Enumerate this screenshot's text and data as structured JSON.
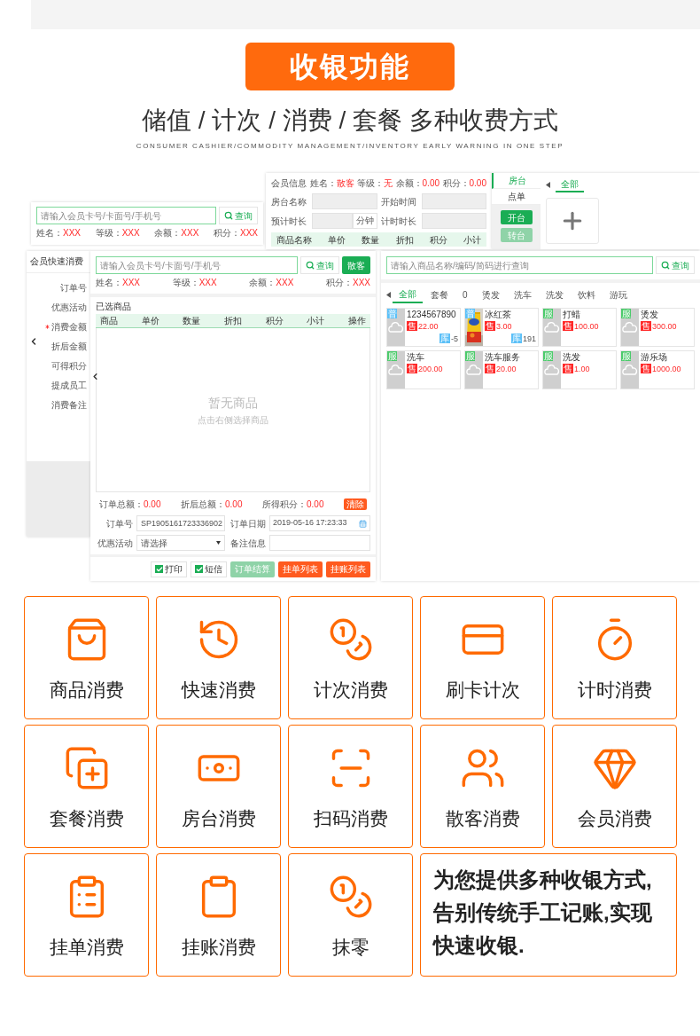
{
  "header": {
    "title": "收银功能",
    "subtitle": "储值 / 计次 / 消费 / 套餐 多种收费方式",
    "tagline": "CONSUMER CASHIER/COMMODITY MANAGEMENT/INVENTORY EARLY WARNING IN ONE STEP"
  },
  "member_lookup": {
    "search_placeholder": "请输入会员卡号/卡面号/手机号",
    "search_button": "查询",
    "info": [
      {
        "label": "姓名：",
        "value": "XXX"
      },
      {
        "label": "等级：",
        "value": "XXX"
      },
      {
        "label": "余额：",
        "value": "XXX"
      },
      {
        "label": "积分：",
        "value": "XXX"
      }
    ]
  },
  "room_panel": {
    "member_label": "会员信息",
    "info": [
      {
        "label": "姓名：",
        "value": "散客"
      },
      {
        "label": "等级：",
        "value": "无"
      },
      {
        "label": "余额：",
        "value": "0.00"
      },
      {
        "label": "积分：",
        "value": "0.00"
      }
    ],
    "fields": [
      {
        "label": "房台名称"
      },
      {
        "label": "开始时间"
      },
      {
        "label": "预计时长",
        "unit": "分钟"
      },
      {
        "label": "计时时长"
      }
    ],
    "columns": [
      "商品名称",
      "单价",
      "数量",
      "折扣",
      "积分",
      "小计"
    ]
  },
  "room_tabs": {
    "tabs": [
      {
        "label": "房台",
        "selected": true
      },
      {
        "label": "点单",
        "selected": false
      }
    ],
    "buttons": [
      {
        "label": "开台",
        "disabled": false
      },
      {
        "label": "转台",
        "disabled": true
      }
    ],
    "area_tabs": [
      {
        "label": "全部",
        "selected": true
      }
    ]
  },
  "sidebar": {
    "title": "会员快速消费",
    "labels": [
      {
        "text": "订单号",
        "required": false
      },
      {
        "text": "优惠活动",
        "required": false
      },
      {
        "text": "消费金额",
        "required": true
      },
      {
        "text": "折后金额",
        "required": false
      },
      {
        "text": "可得积分",
        "required": false
      },
      {
        "text": "提成员工",
        "required": false
      },
      {
        "text": "消费备注",
        "required": false
      }
    ]
  },
  "order": {
    "search_placeholder": "请输入会员卡号/卡面号/手机号",
    "search_button": "查询",
    "guest_button": "散客",
    "info": [
      {
        "label": "姓名：",
        "value": "XXX"
      },
      {
        "label": "等级：",
        "value": "XXX"
      },
      {
        "label": "余额：",
        "value": "XXX"
      },
      {
        "label": "积分：",
        "value": "XXX"
      }
    ],
    "section_title": "已选商品",
    "columns": [
      "商品",
      "单价",
      "数量",
      "折扣",
      "积分",
      "小计",
      "操作"
    ],
    "empty_title": "暂无商品",
    "empty_hint": "点击右侧选择商品",
    "totals": [
      {
        "label": "订单总额：",
        "value": "0.00"
      },
      {
        "label": "折后总额：",
        "value": "0.00"
      },
      {
        "label": "所得积分：",
        "value": "0.00"
      }
    ],
    "clear_button": "清除",
    "fields": [
      {
        "label": "订单号",
        "kind": "text",
        "value": "SP1905161723336902"
      },
      {
        "label": "订单日期",
        "kind": "date",
        "value": "2019-05-16 17:23:33"
      },
      {
        "label": "优惠活动",
        "kind": "select",
        "value": "请选择"
      },
      {
        "label": "备注信息",
        "kind": "text"
      }
    ],
    "options": [
      {
        "label": "打印",
        "checked": true
      },
      {
        "label": "短信",
        "checked": true
      }
    ],
    "actions": [
      {
        "label": "订单结算",
        "kind": "confirm",
        "disabled": true
      },
      {
        "label": "挂单列表",
        "kind": "list",
        "disabled": false
      },
      {
        "label": "挂账列表",
        "kind": "list",
        "disabled": false
      }
    ]
  },
  "products": {
    "search_placeholder": "请输入商品名称/编码/简码进行查询",
    "search_button": "查询",
    "categories": [
      {
        "label": "全部",
        "selected": true
      },
      {
        "label": "套餐",
        "selected": false
      },
      {
        "label": "0",
        "selected": false
      },
      {
        "label": "烫发",
        "selected": false
      },
      {
        "label": "洗车",
        "selected": false
      },
      {
        "label": "洗发",
        "selected": false
      },
      {
        "label": "饮料",
        "selected": false
      },
      {
        "label": "游玩",
        "selected": false
      }
    ],
    "items": [
      {
        "name": "1234567890",
        "tag": "普",
        "kind": "goods",
        "price_label": "售",
        "price": "22.00",
        "stock_label": "库",
        "stock": "-5"
      },
      {
        "name": "冰红茶",
        "tag": "普",
        "kind": "goods",
        "price_label": "售",
        "price": "3.00",
        "stock_label": "库",
        "stock": "191"
      },
      {
        "name": "打蜡",
        "tag": "服",
        "kind": "service",
        "price_label": "售",
        "price": "100.00"
      },
      {
        "name": "烫发",
        "tag": "服",
        "kind": "service",
        "price_label": "售",
        "price": "300.00"
      },
      {
        "name": "洗车",
        "tag": "服",
        "kind": "service",
        "price_label": "售",
        "price": "200.00"
      },
      {
        "name": "洗车服务",
        "tag": "服",
        "kind": "service",
        "price_label": "售",
        "price": "20.00"
      },
      {
        "name": "洗发",
        "tag": "服",
        "kind": "service",
        "price_label": "售",
        "price": "1.00"
      },
      {
        "name": "游乐场",
        "tag": "服",
        "kind": "service",
        "price_label": "售",
        "price": "1000.00"
      }
    ]
  },
  "features": [
    {
      "label": "商品消费"
    },
    {
      "label": "快速消费"
    },
    {
      "label": "计次消费"
    },
    {
      "label": "刷卡计次"
    },
    {
      "label": "计时消费"
    },
    {
      "label": "套餐消费"
    },
    {
      "label": "房台消费"
    },
    {
      "label": "扫码消费"
    },
    {
      "label": "散客消费"
    },
    {
      "label": "会员消费"
    },
    {
      "label": "挂单消费"
    },
    {
      "label": "挂账消费"
    },
    {
      "label": "抹零"
    }
  ],
  "note": "为您提供多种收银方式,告别传统手工记账,实现快速收银."
}
